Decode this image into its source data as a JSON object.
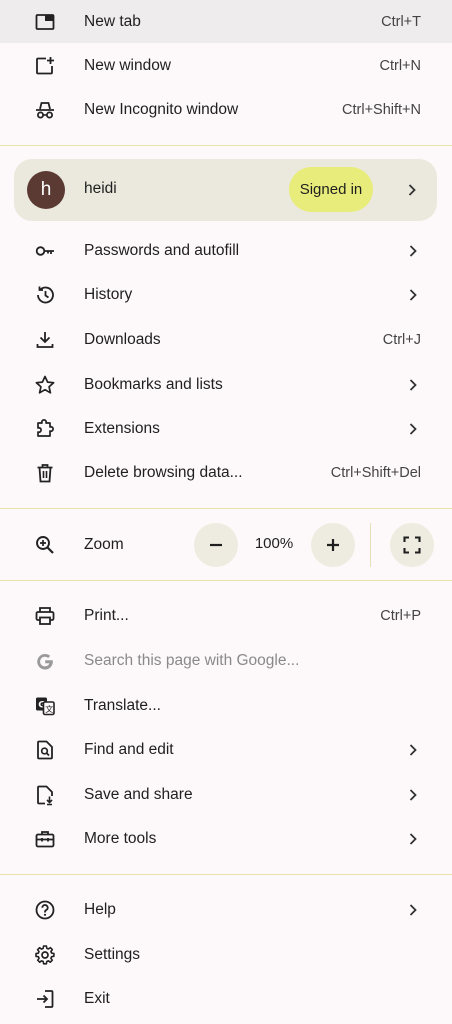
{
  "menu": {
    "new_tab": {
      "label": "New tab",
      "shortcut": "Ctrl+T"
    },
    "new_window": {
      "label": "New window",
      "shortcut": "Ctrl+N"
    },
    "new_incognito": {
      "label": "New Incognito window",
      "shortcut": "Ctrl+Shift+N"
    },
    "profile": {
      "initial": "h",
      "name": "heidi",
      "status": "Signed in"
    },
    "passwords": {
      "label": "Passwords and autofill"
    },
    "history": {
      "label": "History"
    },
    "downloads": {
      "label": "Downloads",
      "shortcut": "Ctrl+J"
    },
    "bookmarks": {
      "label": "Bookmarks and lists"
    },
    "extensions": {
      "label": "Extensions"
    },
    "delete_data": {
      "label": "Delete browsing data...",
      "shortcut": "Ctrl+Shift+Del"
    },
    "zoom": {
      "label": "Zoom",
      "value": "100%"
    },
    "print": {
      "label": "Print...",
      "shortcut": "Ctrl+P"
    },
    "search_page": {
      "label": "Search this page with Google..."
    },
    "translate": {
      "label": "Translate..."
    },
    "find_edit": {
      "label": "Find and edit"
    },
    "save_share": {
      "label": "Save and share"
    },
    "more_tools": {
      "label": "More tools"
    },
    "help": {
      "label": "Help"
    },
    "settings": {
      "label": "Settings"
    },
    "exit": {
      "label": "Exit"
    }
  },
  "colors": {
    "background": "#fdf8f9",
    "highlight": "#efeced",
    "avatar": "#5a3a32",
    "signed_in_badge": "#e8ec7a",
    "separator": "#eae3a6"
  }
}
